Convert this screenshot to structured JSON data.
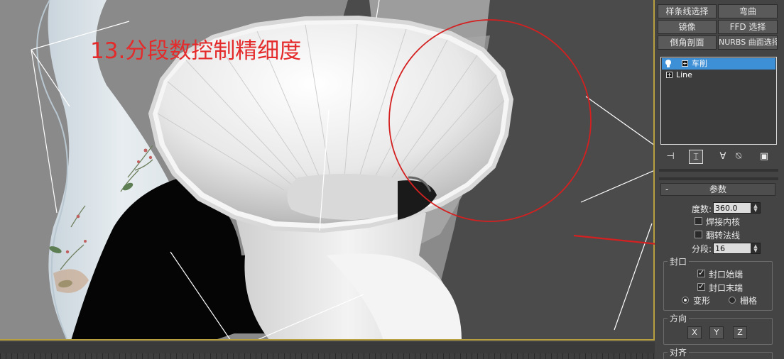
{
  "caption": "13.分段数控制精细度",
  "modifier_buttons": [
    {
      "label": "样条线选择",
      "name": "spline-select-button"
    },
    {
      "label": "弯曲",
      "name": "bend-button"
    },
    {
      "label": "镜像",
      "name": "mirror-button"
    },
    {
      "label": "FFD 选择",
      "name": "ffd-select-button"
    },
    {
      "label": "倒角剖面",
      "name": "bevel-profile-button"
    },
    {
      "label": "NURBS 曲面选择",
      "name": "nurbs-surface-select-button"
    }
  ],
  "stack": {
    "items": [
      {
        "label": "车削",
        "selected": true
      },
      {
        "label": "Line",
        "selected": false
      }
    ]
  },
  "parameters": {
    "title": "参数",
    "collapse": "-",
    "degrees_label": "度数:",
    "degrees_value": "360.0",
    "weld_core_label": "焊接内核",
    "weld_core_checked": false,
    "flip_normals_label": "翻转法线",
    "flip_normals_checked": false,
    "segments_label": "分段:",
    "segments_value": "16",
    "capping": {
      "title": "封口",
      "cap_start_label": "封口始端",
      "cap_start_checked": true,
      "cap_end_label": "封口末端",
      "cap_end_checked": true,
      "morph_label": "变形",
      "grid_label": "栅格",
      "selected": "变形"
    },
    "direction": {
      "title": "方向",
      "axes": [
        "X",
        "Y",
        "Z"
      ]
    },
    "align": {
      "title": "对齐"
    }
  },
  "colors": {
    "caption": "#e42a2a",
    "selection": "#3d8fd6",
    "viewport_border": "#b8a040",
    "annotation_red": "#d42020"
  }
}
